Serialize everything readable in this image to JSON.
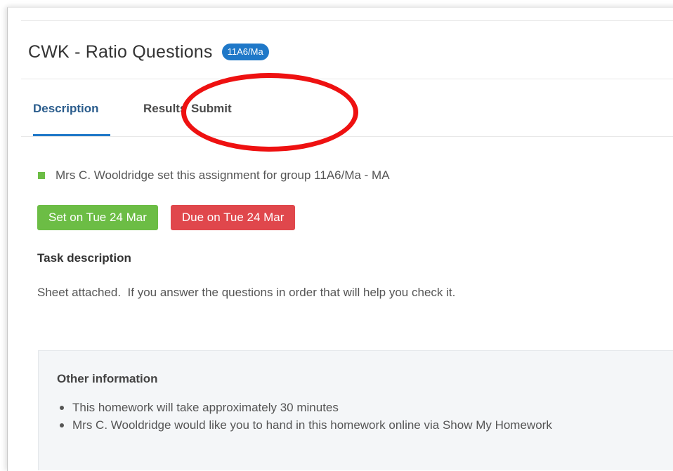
{
  "assignment": {
    "title": "CWK - Ratio Questions",
    "group_badge": "11A6/Ma"
  },
  "tabs": [
    {
      "label": "Description",
      "active": true
    },
    {
      "label": "Results",
      "active": false
    },
    {
      "label": "Submit",
      "active": false
    }
  ],
  "setter_line": "Mrs C. Wooldridge set this assignment for group 11A6/Ma - MA",
  "dates": {
    "set_label": "Set on Tue 24 Mar",
    "due_label": "Due on Tue 24 Mar"
  },
  "task": {
    "heading": "Task description",
    "text": "Sheet attached.  If you answer the questions in order that will help you check it."
  },
  "other_info": {
    "heading": "Other information",
    "items": [
      "This homework will take approximately 30 minutes",
      "Mrs C. Wooldridge would like you to hand in this homework online via Show My Homework"
    ]
  },
  "colors": {
    "accent_blue": "#1f78c8",
    "set_green": "#6cbd45",
    "due_red": "#e0474c",
    "annotation_red": "#ee1111"
  },
  "annotation": {
    "shape": "ellipse",
    "target": "Submit tab"
  }
}
